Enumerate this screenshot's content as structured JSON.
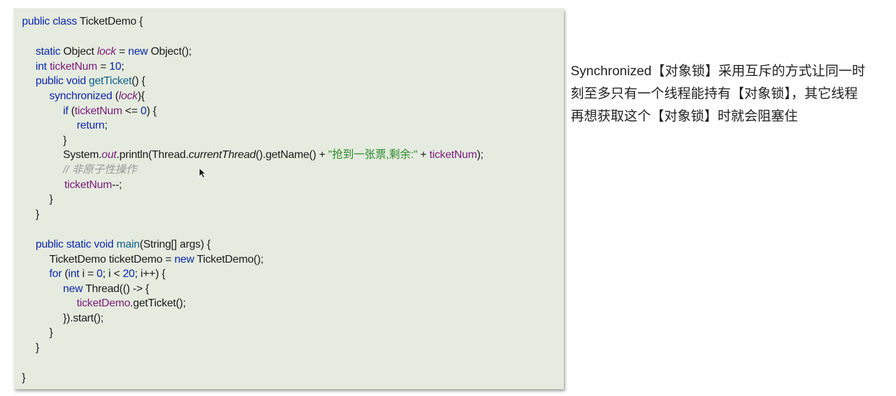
{
  "code": {
    "class_decl": {
      "kw": "public class",
      "name": "TicketDemo",
      "brace": "{"
    },
    "lock_decl": {
      "kw1": "static",
      "type": "Object",
      "field": "lock",
      "eq": "=",
      "kw2": "new",
      "ctor": "Object();"
    },
    "ticket_decl": {
      "kw": "int",
      "field": "ticketNum",
      "eq": "=",
      "num": "10",
      "semi": ";"
    },
    "method_decl": {
      "kw": "public void",
      "name": "getTicket",
      "rest": "() {"
    },
    "sync": {
      "kw": "synchronized",
      "open": "(",
      "field": "lock",
      "close": "){"
    },
    "if_stmt": {
      "kw": "if",
      "open": "(",
      "field": "ticketNum",
      "op": "<=",
      "num": "0",
      "close": ") {"
    },
    "return_stmt": {
      "kw": "return",
      "semi": ";"
    },
    "brace_close": "}",
    "print_stmt": {
      "p1": "System.",
      "p2": "out",
      "p3": ".println(Thread.",
      "p4": "currentThread",
      "p5": "().getName() + ",
      "str": "\"抢到一张票,剩余:\"",
      "p6": " + ",
      "field": "ticketNum",
      "p7": ");"
    },
    "comment": "// 非原子性操作",
    "decrement": {
      "field": "ticketNum",
      "op": "--;"
    },
    "main_decl": {
      "kw": "public static void",
      "name": "main",
      "rest": "(String[] args) {"
    },
    "demo_decl": {
      "type": "TicketDemo ticketDemo =",
      "kw": "new",
      "ctor": "TicketDemo();"
    },
    "for_stmt": {
      "kw": "for",
      "open": "(",
      "kw2": "int",
      "mid1": "i =",
      "num0": "0",
      "mid2": "; i <",
      "num20": "20",
      "end": "; i++) {"
    },
    "thread_stmt": {
      "kw": "new",
      "rest": "Thread(() -> {"
    },
    "call_stmt": {
      "obj": "ticketDemo",
      "rest": ".getTicket();"
    },
    "start_stmt": "}).start();"
  },
  "description": {
    "line1": "Synchronized【对象锁】采用互斥的方式让同一时",
    "line2": "刻至多只有一个线程能持有【对象锁】，其它线程",
    "line3": "再想获取这个【对象锁】时就会阻塞住"
  },
  "colors": {
    "code_background": "#e5ebdf",
    "keyword": "#0b27a8",
    "field": "#7a1a7a",
    "string": "#2e8b2e",
    "comment": "#9a9a9a"
  },
  "icons": {
    "cursor": "mouse-pointer-icon"
  }
}
